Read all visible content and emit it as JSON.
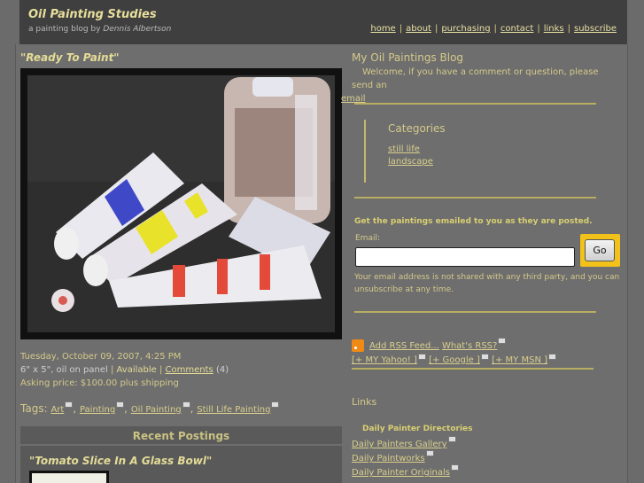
{
  "header": {
    "title": "Oil Painting Studies",
    "subtitle_prefix": "a painting blog by ",
    "author": "Dennis Albertson",
    "nav": [
      "home",
      "about",
      "purchasing",
      "contact",
      "links",
      "subscribe"
    ]
  },
  "post": {
    "title": "\"Ready To Paint\"",
    "date": "Tuesday, October 09, 2007, 4:25 PM",
    "size_medium": "6\" x 5\", oil on panel",
    "availability": "Available",
    "comments_label": "Comments",
    "comments_count": "(4)",
    "price": "Asking price: $100.00 plus shipping",
    "tags_label": "Tags:",
    "tags": [
      "Art",
      "Painting",
      "Oil Painting",
      "Still Life Painting"
    ]
  },
  "recent": {
    "heading": "Recent Postings",
    "first_title": "\"Tomato Slice In A Glass Bowl\""
  },
  "sidebar": {
    "title": "My Oil Paintings Blog",
    "welcome": "Welcome, if you have a comment or question, please send an",
    "welcome_link": "email",
    "categories_title": "Categories",
    "categories": [
      "still life",
      "landscape"
    ],
    "email_heading": "Get the paintings emailed to you as they are posted.",
    "email_label": "Email:",
    "email_value": "",
    "go_label": "Go",
    "email_note": "Your email address is not shared with any third party, and you can unsubscribe at any time.",
    "rss_add": "Add RSS Feed...",
    "rss_what": "What's RSS?",
    "feeds": [
      "[+ MY Yahoo! ]",
      "[+ Google ]",
      "[+ MY MSN ]"
    ],
    "links_title": "Links",
    "links_sub": "Daily Painter Directories",
    "links": [
      "Daily Painters Gallery",
      "Daily Paintworks",
      "Daily Painter Originals"
    ]
  }
}
